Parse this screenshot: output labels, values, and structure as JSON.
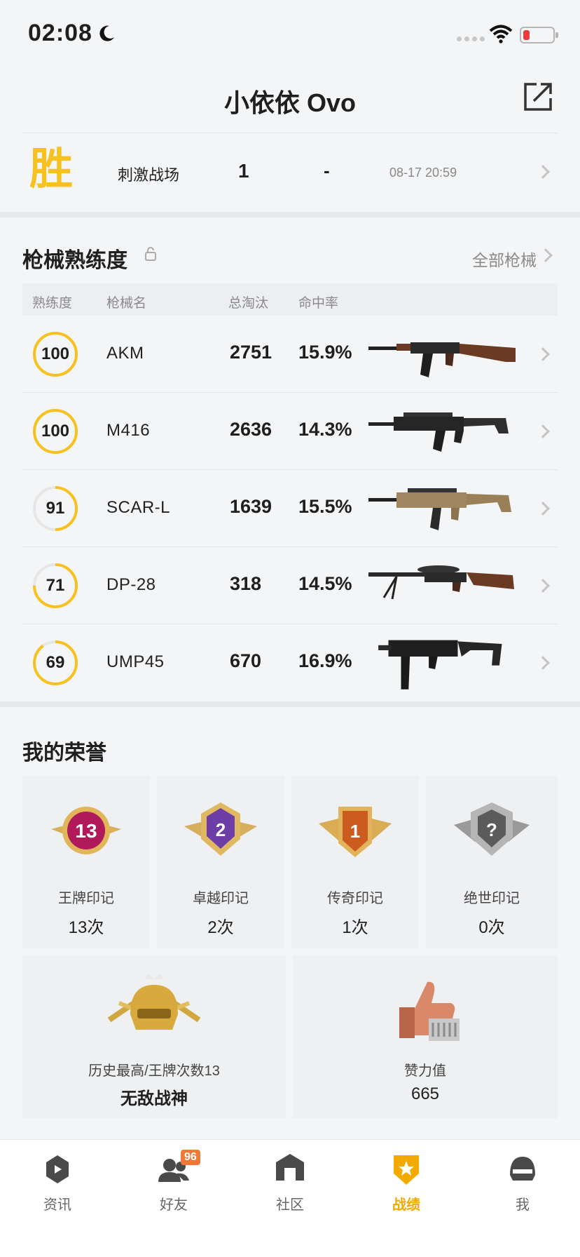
{
  "status": {
    "time": "02:08"
  },
  "header": {
    "title": "小依依 Ovo"
  },
  "match": {
    "result": "胜",
    "mode": "刺激战场",
    "rank": "1",
    "dash": "-",
    "time": "08-17 20:59"
  },
  "weapons": {
    "title": "枪械熟练度",
    "all_link": "全部枪械",
    "columns": [
      "熟练度",
      "枪械名",
      "总淘汰",
      "命中率"
    ],
    "rows": [
      {
        "proficiency": "100",
        "progress": 1.0,
        "name": "AKM",
        "kills": "2751",
        "accuracy": "15.9%"
      },
      {
        "proficiency": "100",
        "progress": 1.0,
        "name": "M416",
        "kills": "2636",
        "accuracy": "14.3%"
      },
      {
        "proficiency": "91",
        "progress": 0.5,
        "name": "SCAR-L",
        "kills": "1639",
        "accuracy": "15.5%"
      },
      {
        "proficiency": "71",
        "progress": 0.75,
        "name": "DP-28",
        "kills": "318",
        "accuracy": "14.5%"
      },
      {
        "proficiency": "69",
        "progress": 0.9,
        "name": "UMP45",
        "kills": "670",
        "accuracy": "16.9%"
      }
    ]
  },
  "honors": {
    "title": "我的荣誉",
    "marks": [
      {
        "label": "王牌印记",
        "value": "13次",
        "emblem_text": "13"
      },
      {
        "label": "卓越印记",
        "value": "2次",
        "emblem_text": "2"
      },
      {
        "label": "传奇印记",
        "value": "1次",
        "emblem_text": "1"
      },
      {
        "label": "绝世印记",
        "value": "0次",
        "emblem_text": "?"
      }
    ],
    "best": {
      "label": "历史最高/王牌次数13",
      "value": "无敌战神"
    },
    "likes": {
      "label": "赞力值",
      "value": "665"
    }
  },
  "tabs": [
    {
      "label": "资讯"
    },
    {
      "label": "好友",
      "badge": "96"
    },
    {
      "label": "社区"
    },
    {
      "label": "战绩",
      "active": true
    },
    {
      "label": "我"
    }
  ],
  "colors": {
    "accent": "#f7c21f",
    "active_tab": "#f2a900",
    "badge": "#f07a35"
  }
}
